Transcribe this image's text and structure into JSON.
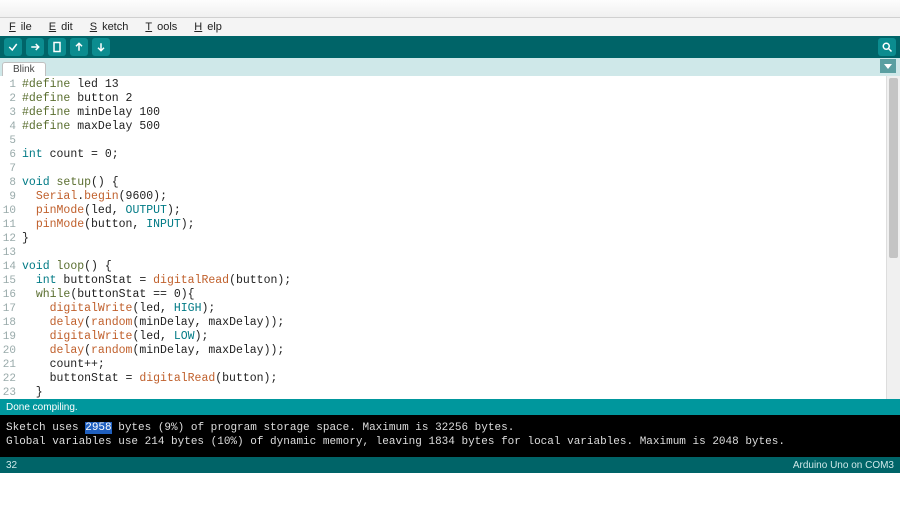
{
  "menu": {
    "file": "File",
    "edit": "Edit",
    "sketch": "Sketch",
    "tools": "Tools",
    "help": "Help"
  },
  "tab": {
    "name": "Blink"
  },
  "code": {
    "lines": [
      {
        "n": 1,
        "html": "<span class='def'>#define</span> led 13"
      },
      {
        "n": 2,
        "html": "<span class='def'>#define</span> button 2"
      },
      {
        "n": 3,
        "html": "<span class='def'>#define</span> minDelay 100"
      },
      {
        "n": 4,
        "html": "<span class='def'>#define</span> maxDelay 500"
      },
      {
        "n": 5,
        "html": ""
      },
      {
        "n": 6,
        "html": "<span class='type'>int</span> count = 0;"
      },
      {
        "n": 7,
        "html": ""
      },
      {
        "n": 8,
        "html": "<span class='type'>void</span> <span class='kw'>setup</span>() {"
      },
      {
        "n": 9,
        "html": "  <span class='fn'>Serial</span>.<span class='fn'>begin</span>(9600);"
      },
      {
        "n": 10,
        "html": "  <span class='fn'>pinMode</span>(led, <span class='const'>OUTPUT</span>);"
      },
      {
        "n": 11,
        "html": "  <span class='fn'>pinMode</span>(button, <span class='const'>INPUT</span>);"
      },
      {
        "n": 12,
        "html": "}"
      },
      {
        "n": 13,
        "html": ""
      },
      {
        "n": 14,
        "html": "<span class='type'>void</span> <span class='kw'>loop</span>() {"
      },
      {
        "n": 15,
        "html": "  <span class='type'>int</span> buttonStat = <span class='fn'>digitalRead</span>(button);"
      },
      {
        "n": 16,
        "html": "  <span class='kw'>while</span>(buttonStat == 0){"
      },
      {
        "n": 17,
        "html": "    <span class='fn'>digitalWrite</span>(led, <span class='const'>HIGH</span>);"
      },
      {
        "n": 18,
        "html": "    <span class='fn'>delay</span>(<span class='fn'>random</span>(minDelay, maxDelay));"
      },
      {
        "n": 19,
        "html": "    <span class='fn'>digitalWrite</span>(led, <span class='const'>LOW</span>);"
      },
      {
        "n": 20,
        "html": "    <span class='fn'>delay</span>(<span class='fn'>random</span>(minDelay, maxDelay));"
      },
      {
        "n": 21,
        "html": "    count++;"
      },
      {
        "n": 22,
        "html": "    buttonStat = <span class='fn'>digitalRead</span>(button);"
      },
      {
        "n": 23,
        "html": "  }"
      }
    ]
  },
  "status": {
    "text": "Done compiling."
  },
  "console": {
    "line1_before": "Sketch uses ",
    "line1_hl": "2958",
    "line1_after": " bytes (9%) of program storage space. Maximum is 32256 bytes.",
    "line2": "Global variables use 214 bytes (10%) of dynamic memory, leaving 1834 bytes for local variables. Maximum is 2048 bytes."
  },
  "footer": {
    "left": "32",
    "right": "Arduino Uno on COM3"
  }
}
